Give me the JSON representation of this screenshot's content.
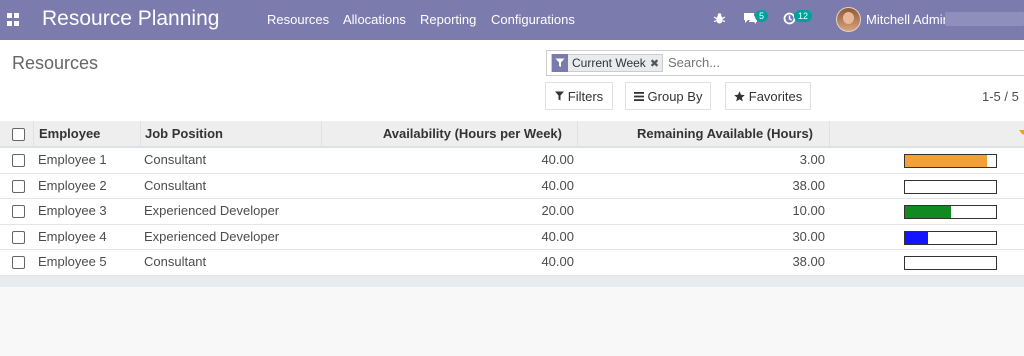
{
  "app": {
    "title": "Resource Planning"
  },
  "menu": [
    "Resources",
    "Allocations",
    "Reporting",
    "Configurations"
  ],
  "systray": {
    "messages_count": "5",
    "activities_count": "12",
    "user_name": "Mitchell Admin"
  },
  "breadcrumb": "Resources",
  "search": {
    "facet_label": "Current Week",
    "placeholder": "Search..."
  },
  "buttons": {
    "filters": "Filters",
    "group_by": "Group By",
    "favorites": "Favorites"
  },
  "pager": "1-5 / 5",
  "table": {
    "headers": {
      "employee": "Employee",
      "job_position": "Job Position",
      "availability": "Availability (Hours per Week)",
      "remaining": "Remaining Available (Hours)"
    },
    "rows": [
      {
        "employee": "Employee 1",
        "job": "Consultant",
        "availability": "40.00",
        "remaining": "3.00",
        "progress": 0.9,
        "color": "#f5a032"
      },
      {
        "employee": "Employee 2",
        "job": "Consultant",
        "availability": "40.00",
        "remaining": "38.00",
        "progress": 0.0,
        "color": "#ffffff"
      },
      {
        "employee": "Employee 3",
        "job": "Experienced Developer",
        "availability": "20.00",
        "remaining": "10.00",
        "progress": 0.5,
        "color": "#108a21"
      },
      {
        "employee": "Employee 4",
        "job": "Experienced Developer",
        "availability": "40.00",
        "remaining": "30.00",
        "progress": 0.25,
        "color": "#1414ff"
      },
      {
        "employee": "Employee 5",
        "job": "Consultant",
        "availability": "40.00",
        "remaining": "38.00",
        "progress": 0.0,
        "color": "#ffffff"
      }
    ]
  },
  "colors": {
    "navbar": "#7c7bad",
    "badge": "#00a09d",
    "caret": "#f0a01e"
  }
}
